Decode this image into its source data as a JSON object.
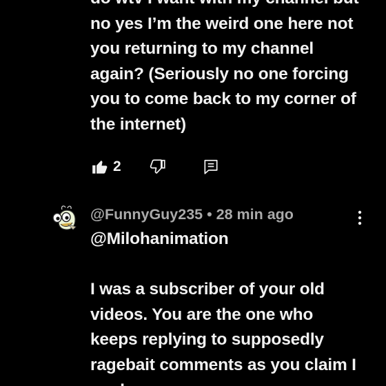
{
  "comment1": {
    "text": "do wtv I want with my channel but\nno yes I’m the weird one here not\nyou returning to my channel\nagain? (Seriously no one forcing\nyou to come back to my corner of\nthe internet)",
    "like_count": "2"
  },
  "comment2": {
    "author": "@FunnyGuy235",
    "separator": " • ",
    "time": "28 min ago",
    "text": "@Milohanimation\n\nI was a subscriber of your old\nvideos. You are the one who\nkeeps replying to supposedly\nragebait comments as you claim I\nmade"
  },
  "icons": {
    "like": "thumbs-up-filled-icon",
    "dislike": "thumbs-down-outline-icon",
    "reply": "reply-comment-icon",
    "more": "more-vertical-icon"
  },
  "colors": {
    "background": "#000000",
    "text": "#f1f1f1",
    "meta": "#aaaaaa"
  }
}
